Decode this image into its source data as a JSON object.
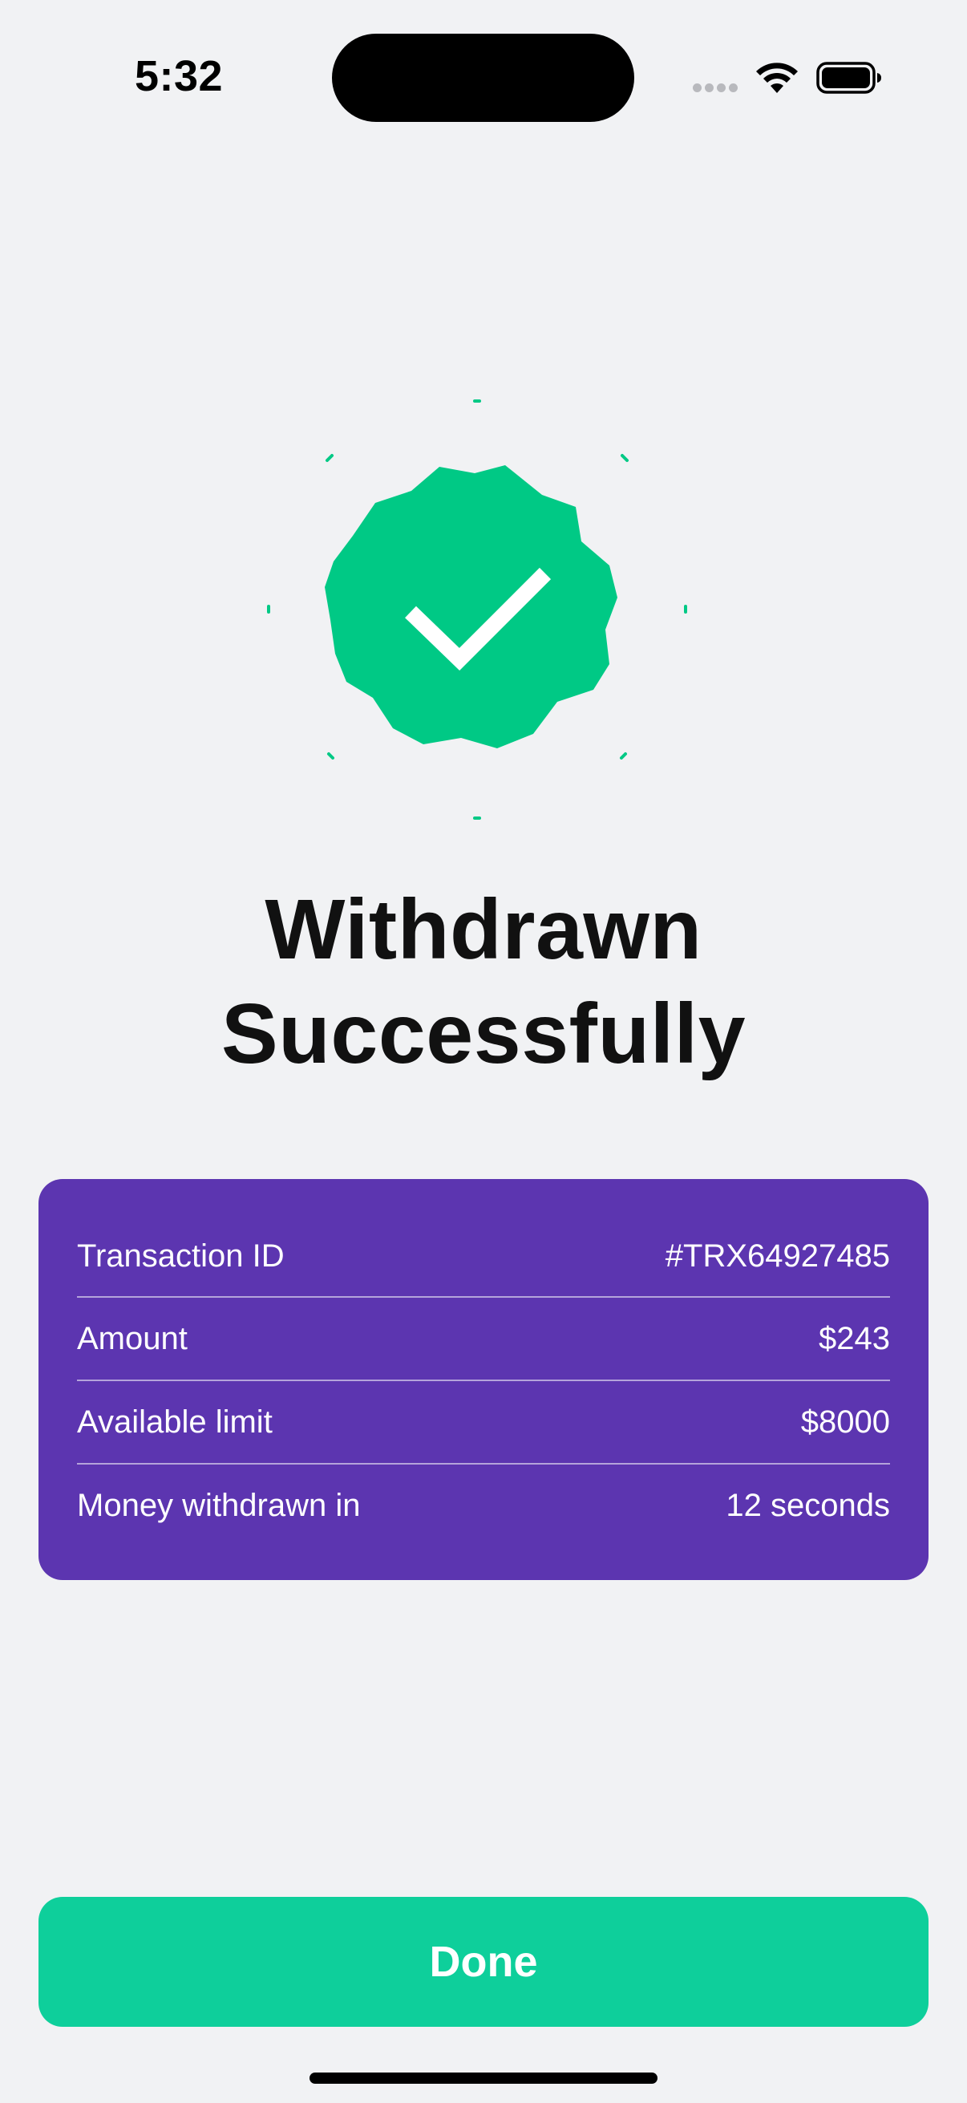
{
  "status_bar": {
    "time": "5:32",
    "signal_icon": "cellular-dots-icon",
    "wifi_icon": "wifi-icon",
    "battery_icon": "battery-icon"
  },
  "badge": {
    "icon": "verified-check-badge-icon",
    "color": "#00C985"
  },
  "title": {
    "line1": "Withdrawn",
    "line2": "Successfully"
  },
  "details": {
    "background": "#5C35B0",
    "rows": [
      {
        "label": "Transaction ID",
        "value": "#TRX64927485"
      },
      {
        "label": "Amount",
        "value": "$243"
      },
      {
        "label": "Available limit",
        "value": "$8000"
      },
      {
        "label": "Money withdrawn in",
        "value": "12 seconds"
      }
    ]
  },
  "done_button": {
    "label": "Done",
    "color": "#0ECF9B"
  }
}
